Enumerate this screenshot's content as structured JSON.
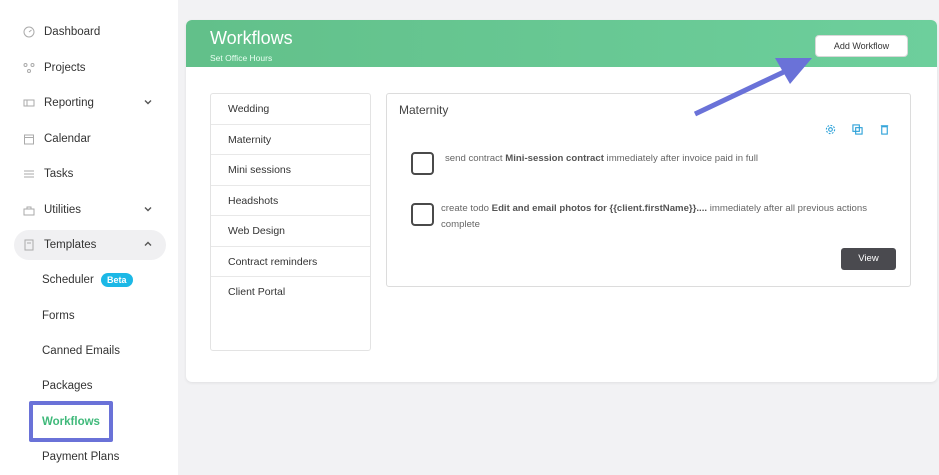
{
  "sidebar": {
    "items": [
      {
        "label": "Dashboard",
        "icon": "dashboard-icon"
      },
      {
        "label": "Projects",
        "icon": "projects-icon"
      },
      {
        "label": "Reporting",
        "icon": "reporting-icon"
      },
      {
        "label": "Calendar",
        "icon": "calendar-icon"
      },
      {
        "label": "Tasks",
        "icon": "tasks-icon"
      },
      {
        "label": "Utilities",
        "icon": "utilities-icon"
      },
      {
        "label": "Templates",
        "icon": "templates-icon"
      }
    ],
    "sub_items": [
      {
        "label": "Scheduler",
        "badge": "Beta"
      },
      {
        "label": "Forms"
      },
      {
        "label": "Canned Emails"
      },
      {
        "label": "Packages"
      },
      {
        "label": "Workflows"
      },
      {
        "label": "Payment Plans"
      }
    ]
  },
  "header": {
    "title": "Workflows",
    "subtitle": "Set Office Hours",
    "add_button": "Add Workflow"
  },
  "workflow_list": [
    "Wedding",
    "Maternity",
    "Mini sessions",
    "Headshots",
    "Web Design",
    "Contract reminders",
    "Client Portal"
  ],
  "detail": {
    "title": "Maternity",
    "steps": [
      {
        "pre": "send contract ",
        "bold": "Mini-session contract",
        "post": " immediately after invoice paid in full"
      },
      {
        "pre": "create todo ",
        "bold": "Edit and email photos for {{client.firstName}}....",
        "post": " immediately after all previous actions complete"
      }
    ],
    "view_button": "View"
  },
  "colors": {
    "header_green": "#62c08a",
    "accent_blue": "#6a72d8",
    "active_green": "#3fb97a",
    "beta_blue": "#1cb8e6"
  }
}
